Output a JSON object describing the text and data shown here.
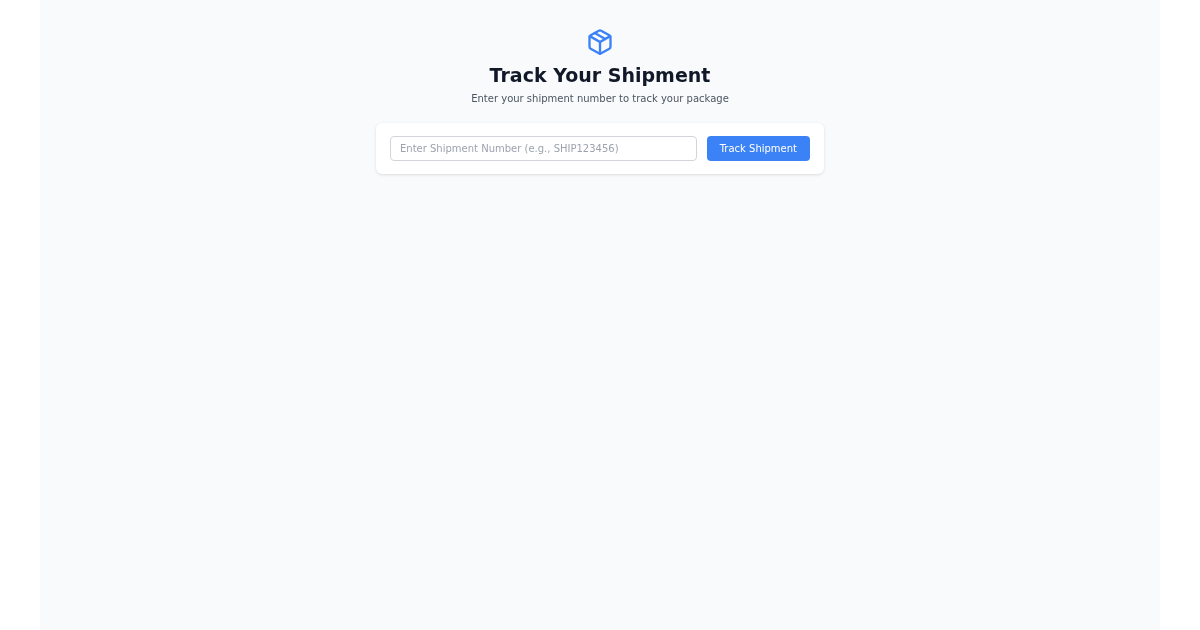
{
  "header": {
    "title": "Track Your Shipment",
    "subtitle": "Enter your shipment number to track your package"
  },
  "search": {
    "placeholder": "Enter Shipment Number (e.g., SHIP123456)",
    "button": "Track Shipment"
  }
}
